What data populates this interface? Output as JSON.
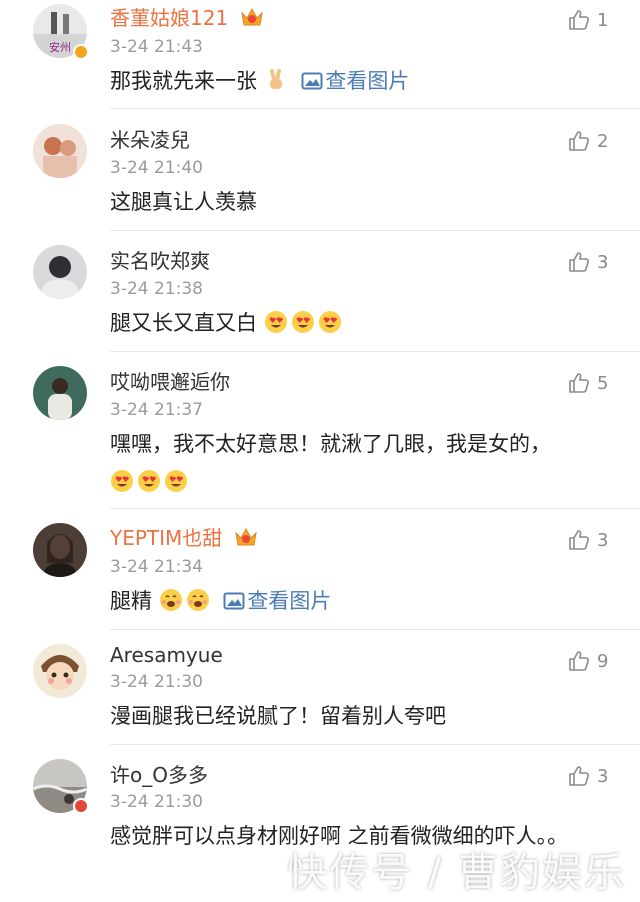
{
  "comments": [
    {
      "username": "香菫姑娘121",
      "vip": true,
      "time": "3-24 21:43",
      "likes": "1",
      "text": "那我就先来一张",
      "view_pic": "查看图片",
      "avatar_caption": "安州"
    },
    {
      "username": "米朵凌兒",
      "vip": false,
      "time": "3-24 21:40",
      "likes": "2",
      "text": "这腿真让人羡慕"
    },
    {
      "username": "实名吹郑爽",
      "vip": false,
      "time": "3-24 21:38",
      "likes": "3",
      "text": "腿又长又直又白"
    },
    {
      "username": "哎呦喂邂逅你",
      "vip": false,
      "time": "3-24 21:37",
      "likes": "5",
      "text": "嘿嘿，我不太好意思！就湫了几眼，我是女的，"
    },
    {
      "username": "YEPTIM也甜",
      "vip": true,
      "time": "3-24 21:34",
      "likes": "3",
      "text": "腿精",
      "view_pic": "查看图片"
    },
    {
      "username": "Aresamyue",
      "vip": false,
      "time": "3-24 21:30",
      "likes": "9",
      "text": "漫画腿我已经说腻了！留着别人夸吧"
    },
    {
      "username": "许o_O多多",
      "vip": false,
      "time": "3-24 21:30",
      "likes": "3",
      "text": "感觉胖可以点身材刚好啊 之前看微微细的吓人。。"
    }
  ],
  "watermark": "快传号 / 曹豹娱乐",
  "colors": {
    "vip_name": "#eb7340",
    "link": "#4a7cb8",
    "meta": "#9b9b9b"
  }
}
